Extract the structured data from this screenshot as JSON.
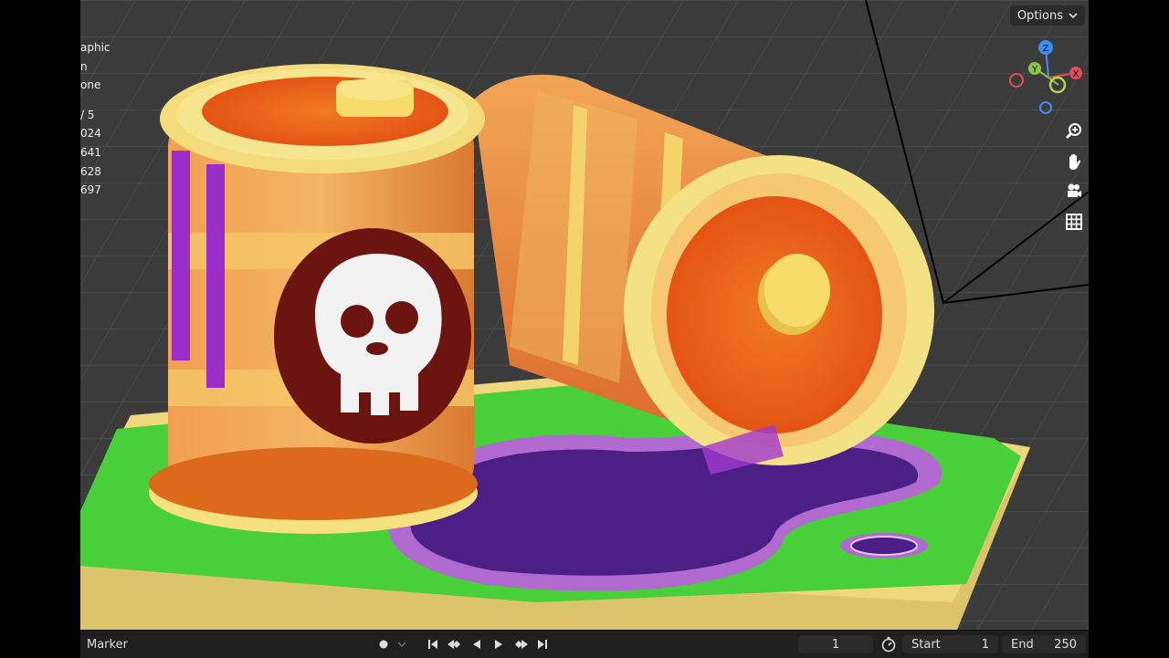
{
  "stats": {
    "lines": [
      "aphic",
      "n",
      "one",
      "",
      "/ 5",
      "024",
      "641",
      "628",
      "697"
    ]
  },
  "header": {
    "options_label": "Options"
  },
  "gizmo": {
    "z_label": "Z",
    "y_label": "Y",
    "x_label": "X"
  },
  "navigation": {
    "tools": [
      "zoom-icon",
      "hand-pan-icon",
      "camera-icon",
      "grid-icon"
    ]
  },
  "timeline": {
    "marker_label": "Marker",
    "current_frame": "1",
    "start_label": "Start",
    "start_value": "1",
    "end_label": "End",
    "end_value": "250"
  },
  "colors": {
    "accent_blue": "#2c6cd8",
    "axis_x": "#e04e5a",
    "axis_y": "#8bc34a",
    "axis_z": "#3d8ef0"
  }
}
